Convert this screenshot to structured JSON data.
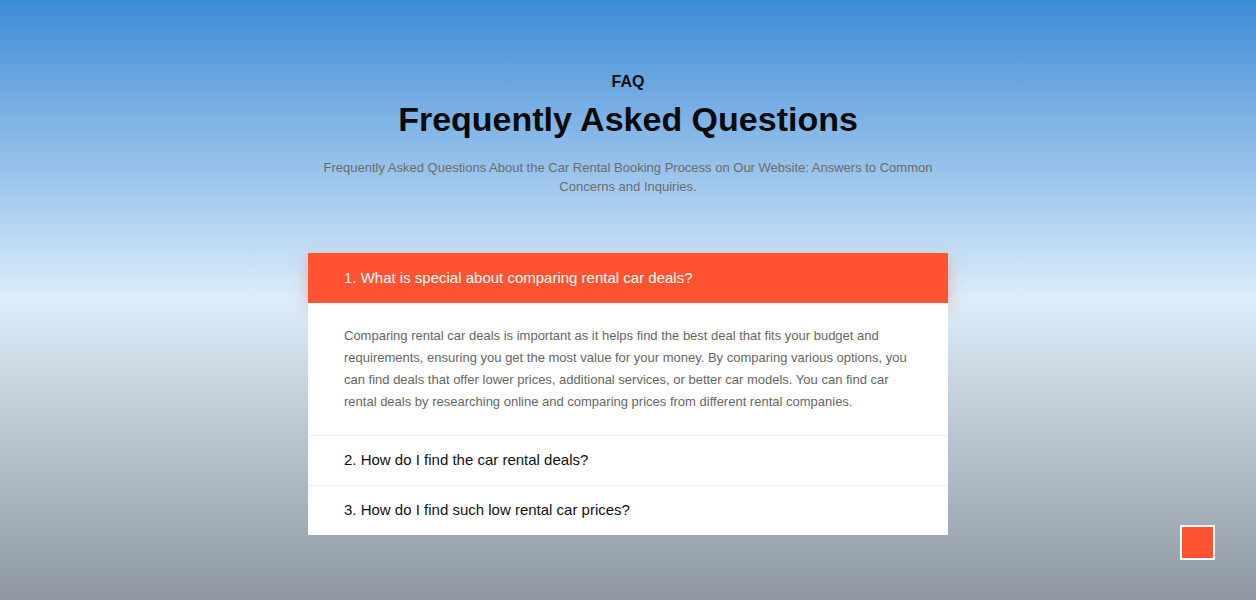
{
  "section": {
    "eyebrow": "FAQ",
    "title": "Frequently Asked Questions",
    "subtitle": "Frequently Asked Questions About the Car Rental Booking Process on Our Website: Answers to Common Concerns and Inquiries."
  },
  "faqs": [
    {
      "question": "1. What is special about comparing rental car deals?",
      "expanded": true,
      "answer": "Comparing rental car deals is important as it helps find the best deal that fits your budget and requirements, ensuring you get the most value for your money. By comparing various options, you can find deals that offer lower prices, additional services, or better car models. You can find car rental deals by researching online and comparing prices from different rental companies."
    },
    {
      "question": "2. How do I find the car rental deals?",
      "expanded": false,
      "answer": ""
    },
    {
      "question": "3. How do I find such low rental car prices?",
      "expanded": false,
      "answer": ""
    }
  ]
}
